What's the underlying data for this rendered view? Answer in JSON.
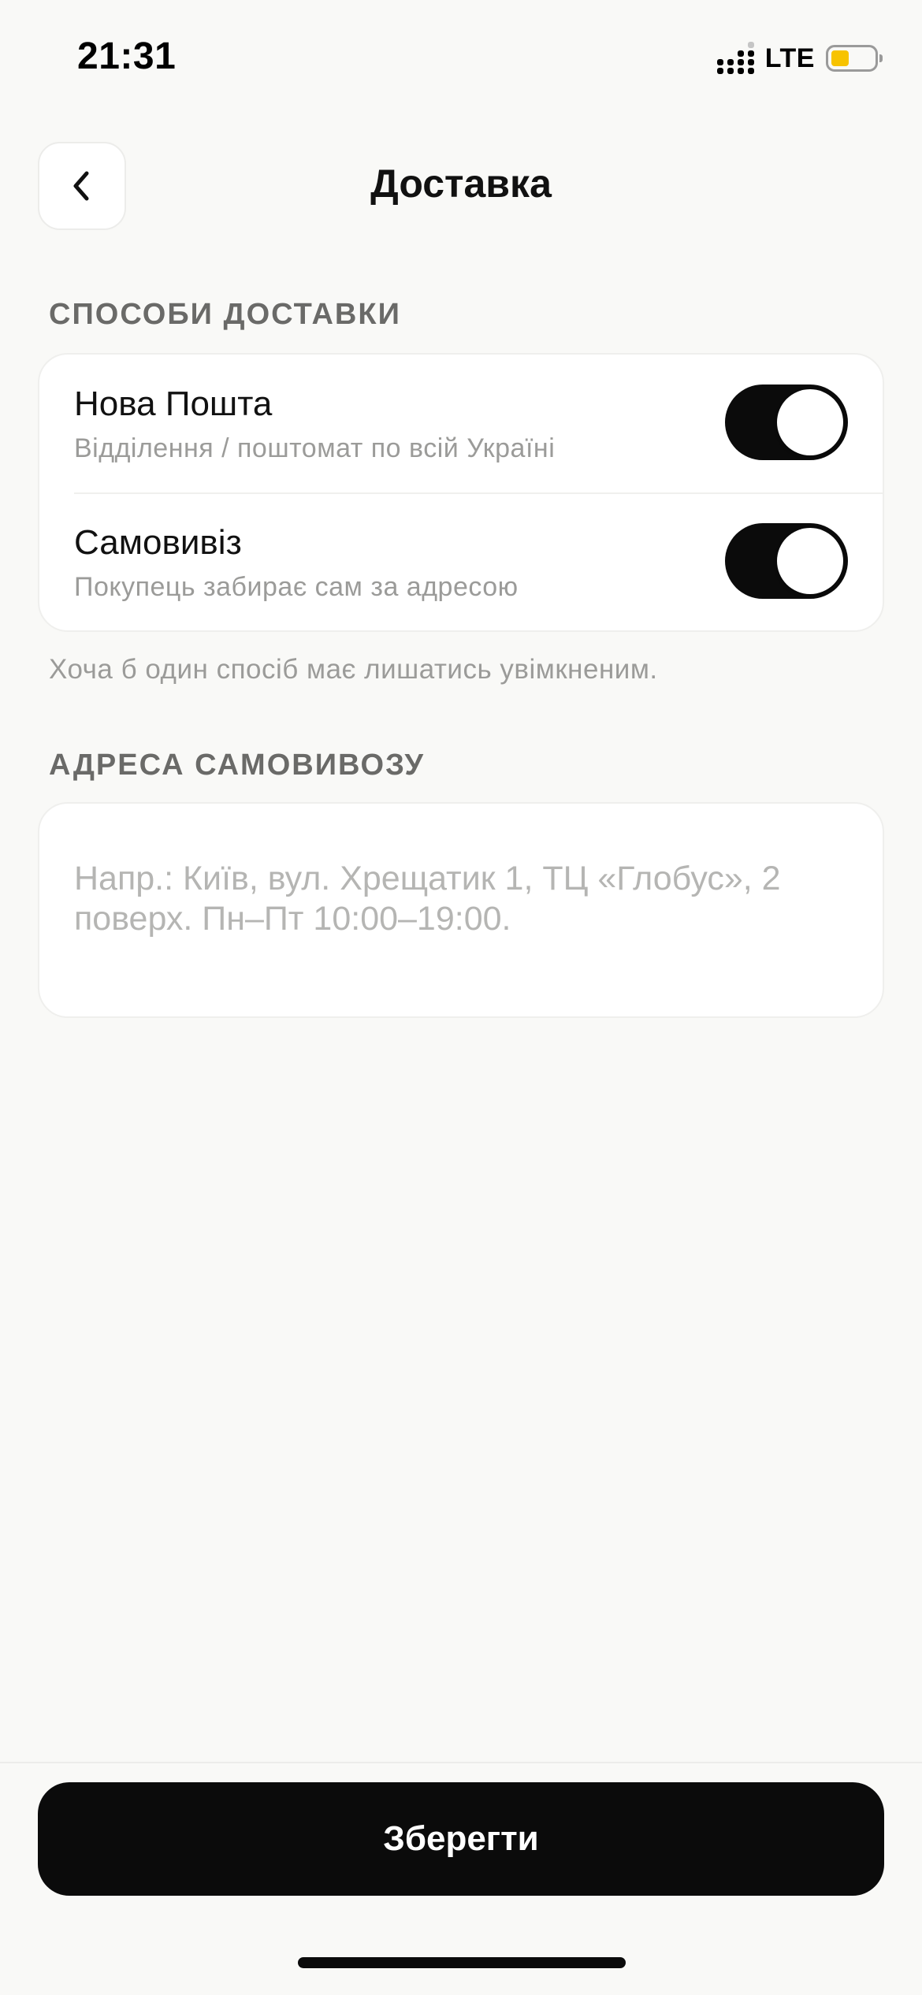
{
  "status_bar": {
    "time": "21:31",
    "network": "LTE",
    "battery_color": "#f7c300",
    "signal_icon": "signal-bars-icon",
    "battery_icon": "battery-low-icon"
  },
  "header": {
    "title": "Доставка",
    "back_icon": "chevron-left-icon"
  },
  "delivery_methods": {
    "section_title": "СПОСОБИ ДОСТАВКИ",
    "items": [
      {
        "title": "Нова Пошта",
        "subtitle": "Відділення / поштомат по всій Україні",
        "enabled": true
      },
      {
        "title": "Самовивіз",
        "subtitle": "Покупець забирає сам за адресою",
        "enabled": true
      }
    ],
    "hint": "Хоча б один спосіб має лишатись увімкненим."
  },
  "pickup_address": {
    "section_title": "АДРЕСА САМОВИВОЗУ",
    "value": "",
    "placeholder": "Напр.: Київ, вул. Хрещатик 1, ТЦ «Глобус», 2 поверх. Пн–Пт 10:00–19:00."
  },
  "footer": {
    "save_label": "Зберегти"
  },
  "colors": {
    "background": "#f9f9f7",
    "accent": "#0b0b0b",
    "card": "#ffffff",
    "muted_text": "#9b9b99"
  }
}
